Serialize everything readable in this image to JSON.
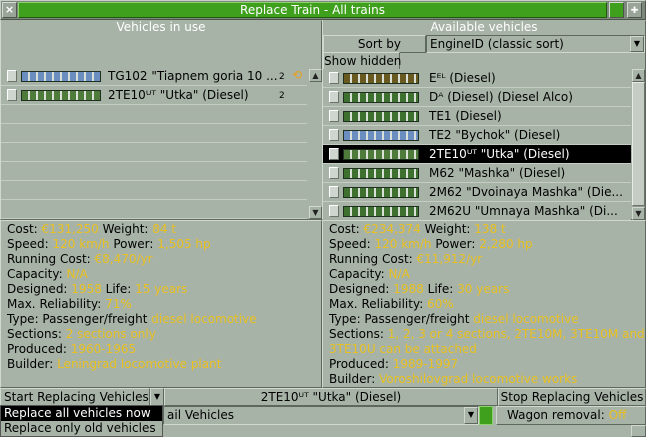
{
  "window": {
    "title": "Replace Train - All trains",
    "close_glyph": "×",
    "sticky_glyph": "●",
    "pin_glyph": "✚"
  },
  "left": {
    "header": "Vehicles in use",
    "rows": [
      {
        "name": "TG102 \"Tiapnem goria 10 ...",
        "count": "2",
        "sprite_color": "#6a8ec0",
        "selected": false,
        "has_autoreplace_icon": true
      },
      {
        "name": "2TE10ᵁᵀ \"Utka\" (Diesel)",
        "count": "2",
        "sprite_color": "#4e7a3a",
        "selected": false,
        "has_autoreplace_icon": false
      }
    ]
  },
  "right": {
    "header": "Available vehicles",
    "sort_label": "Sort by",
    "sort_value": "EngineID (classic sort)",
    "show_hidden": "Show hidden",
    "rows": [
      {
        "name": "Eᴱᴸ (Diesel)",
        "sprite_color": "#6a5a20",
        "selected": false
      },
      {
        "name": "Dᴬ (Diesel) (Diesel Alco)",
        "sprite_color": "#3e7030",
        "selected": false
      },
      {
        "name": "TE1 (Diesel)",
        "sprite_color": "#3e7030",
        "selected": false
      },
      {
        "name": "TE2 \"Bychok\" (Diesel)",
        "sprite_color": "#6a8ec0",
        "selected": false
      },
      {
        "name": "2TE10ᵁᵀ \"Utka\" (Diesel)",
        "sprite_color": "#4e7a3a",
        "selected": true
      },
      {
        "name": "M62 \"Mashka\" (Diesel)",
        "sprite_color": "#3e7030",
        "selected": false
      },
      {
        "name": "2M62 \"Dvoinaya Mashka\" (Die...",
        "sprite_color": "#3e7030",
        "selected": false
      },
      {
        "name": "2M62U \"Umnaya Mashka\" (Di...",
        "sprite_color": "#3e7030",
        "selected": false
      }
    ]
  },
  "left_info": {
    "cost_label": "Cost: ",
    "cost": "€131,250",
    "weight_label": " Weight: ",
    "weight": "84 t",
    "speed_label": "Speed: ",
    "speed": "120 km/h",
    "power_label": " Power: ",
    "power": "1,505 hp",
    "running_label": "Running Cost: ",
    "running": "€8,470/yr",
    "capacity_label": "Capacity: ",
    "capacity": "N/A",
    "designed_label": "Designed: ",
    "designed": "1958",
    "life_label": " Life: ",
    "life": "15 years",
    "reliability_label": "Max. Reliability: ",
    "reliability": "71%",
    "type_label": "Type: Passenger/freight ",
    "type": "diesel locomotive",
    "sections_label": "Sections: ",
    "sections": "2 sections only",
    "produced_label": "Produced: ",
    "produced": "1960-1965",
    "builder_label": "Builder: ",
    "builder": "Leningrad locomotive plant"
  },
  "right_info": {
    "cost_label": "Cost: ",
    "cost": "€234,374",
    "weight_label": " Weight: ",
    "weight": "138 t",
    "speed_label": "Speed: ",
    "speed": "120 km/h",
    "power_label": " Power: ",
    "power": "2,280 hp",
    "running_label": "Running Cost: ",
    "running": "€11,912/yr",
    "capacity_label": "Capacity: ",
    "capacity": "N/A",
    "designed_label": "Designed: ",
    "designed": "1988",
    "life_label": " Life: ",
    "life": "30 years",
    "reliability_label": "Max. Reliability: ",
    "reliability": "60%",
    "type_label": "Type: Passenger/freight ",
    "type": "diesel locomotive",
    "sections_label": "Sections: ",
    "sections_line1": "1, 2, 3 or 4 sections, 2TE10M, 3TE10M and",
    "sections_line2": "3TE10U can be attached",
    "produced_label": "Produced: ",
    "produced": "1989-1997",
    "builder_label": "Builder: ",
    "builder": "Voroshilovgrad locomotive works"
  },
  "bottom": {
    "start_label": "Start Replacing Vehicles",
    "replacement_text": "2TE10ᵁᵀ \"Utka\" (Diesel)",
    "stop_label": "Stop Replacing Vehicles",
    "rail_dropdown_value": "ail Vehicles",
    "wagon_removal_label": "Wagon removal: ",
    "wagon_removal_value": "Off",
    "popup_options": [
      "Replace all vehicles now",
      "Replace only old vehicles"
    ]
  }
}
